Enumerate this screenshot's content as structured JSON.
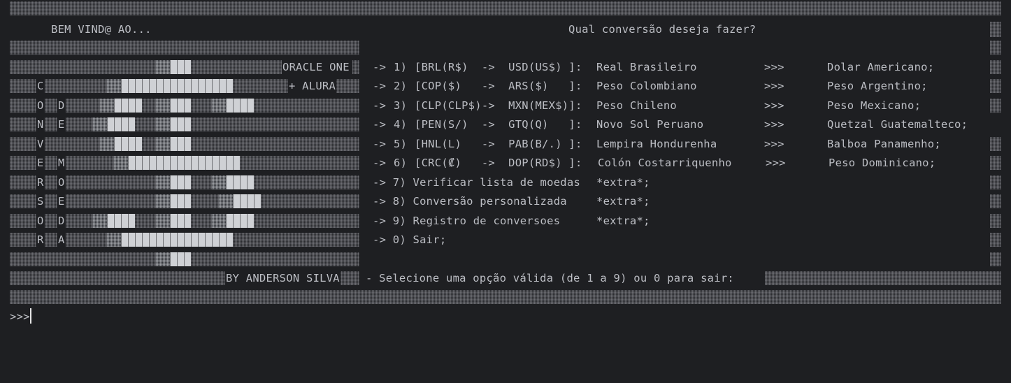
{
  "header": {
    "welcome": "BEM VIND@ AO...",
    "question": "Qual conversão deseja fazer?"
  },
  "logo": {
    "oracle": "ORACLE ONE",
    "plus_alura": "+ ALURA",
    "left_letters": [
      "C",
      "O",
      "N",
      "V",
      "E",
      "R",
      "S",
      "O",
      "R"
    ],
    "inner_letters": [
      "D",
      "E",
      "M",
      "O",
      "E",
      "D",
      "A"
    ],
    "byline": "BY ANDERSON SILVA"
  },
  "menu": {
    "options": [
      {
        "arrow": "->",
        "num": "1)",
        "code": "[BRL(R$)  ->  USD(US$) ]:",
        "from": "Real Brasileiro",
        "sep": ">>>",
        "to": "Dolar Americano;"
      },
      {
        "arrow": "->",
        "num": "2)",
        "code": "[COP($)   ->  ARS($)   ]:",
        "from": "Peso Colombiano",
        "sep": ">>>",
        "to": "Peso Argentino;"
      },
      {
        "arrow": "->",
        "num": "3)",
        "code": "[CLP(CLP$)->  MXN(MEX$)]:",
        "from": "Peso Chileno",
        "sep": ">>>",
        "to": "Peso Mexicano;"
      },
      {
        "arrow": "->",
        "num": "4)",
        "code": "[PEN(S/)  ->  GTQ(Q)   ]:",
        "from": "Novo Sol Peruano",
        "sep": ">>>",
        "to": "Quetzal Guatemalteco;"
      },
      {
        "arrow": "->",
        "num": "5)",
        "code": "[HNL(L)   ->  PAB(B/.) ]:",
        "from": "Lempira Hondurenha",
        "sep": ">>>",
        "to": "Balboa Panamenho;"
      },
      {
        "arrow": "->",
        "num": "6)",
        "code": "[CRC(₡)   ->  DOP(RD$) ]:",
        "from": "Colón Costarriquenho",
        "sep": ">>>",
        "to": "Peso Dominicano;"
      }
    ],
    "extras": [
      {
        "text": "-> 7) Verificar lista de moedas",
        "tag": "*extra*;"
      },
      {
        "text": "-> 8) Conversão personalizada",
        "tag": "*extra*;"
      },
      {
        "text": "-> 9) Registro de conversoes",
        "tag": "*extra*;"
      }
    ],
    "exit": "-> 0) Sair;",
    "select_prompt": "- Selecione uma opção válida (de 1 a 9) ou 0 para sair:"
  },
  "prompt": {
    "symbol": ">>>",
    "input_value": ""
  }
}
